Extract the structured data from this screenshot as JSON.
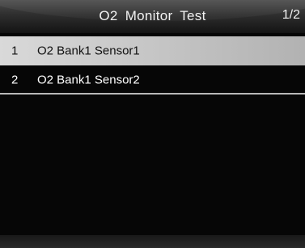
{
  "header": {
    "title": "O2  Monitor  Test",
    "page_indicator": "1/2"
  },
  "list": {
    "items": [
      {
        "index": "1",
        "label": "O2 Bank1 Sensor1",
        "selected": true
      },
      {
        "index": "2",
        "label": "O2 Bank1 Sensor2",
        "selected": false
      }
    ]
  },
  "colors": {
    "background": "#060606",
    "selected_row": "#c8c8c8",
    "text": "#ffffff",
    "selected_text": "#111111"
  }
}
